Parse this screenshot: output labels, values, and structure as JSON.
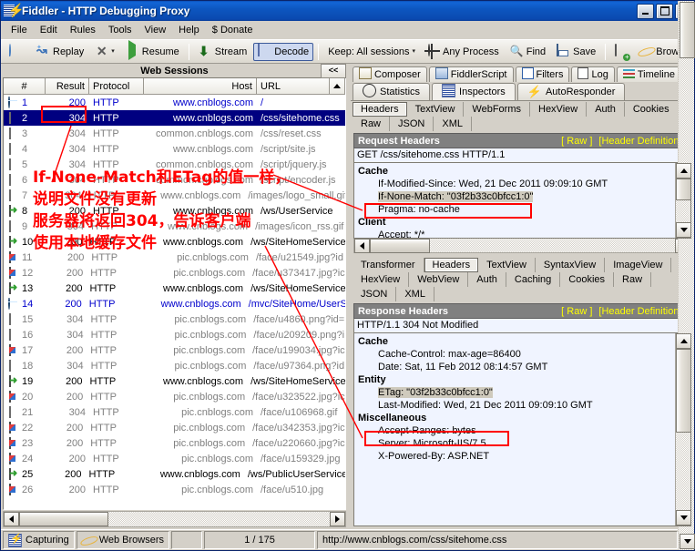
{
  "window": {
    "title": "Fiddler - HTTP Debugging Proxy",
    "icon": "fiddler-icon",
    "minimize": "_",
    "maximize": "□",
    "close": "✕"
  },
  "menu": [
    {
      "label": "File"
    },
    {
      "label": "Edit"
    },
    {
      "label": "Rules"
    },
    {
      "label": "Tools"
    },
    {
      "label": "View"
    },
    {
      "label": "Help"
    },
    {
      "label": "$ Donate"
    }
  ],
  "toolbar": {
    "comment_label": "",
    "replay_label": "Replay",
    "remove_label": "",
    "remove_caret": "▾",
    "resume_label": "Resume",
    "stream_label": "Stream",
    "decode_label": "Decode",
    "keep_label": "Keep: All sessions",
    "keep_caret": "▾",
    "process_label": "Any Process",
    "find_label": "Find",
    "save_label": "Save",
    "browse_label": "Browse",
    "overflow": "▾"
  },
  "sessions": {
    "caption": "Web Sessions",
    "collapse_label": "<<",
    "columns": [
      "#",
      "Result",
      "Protocol",
      "Host",
      "URL"
    ],
    "rows": [
      {
        "icon": "globe-icon",
        "num": "1",
        "result": "200",
        "protocol": "HTTP",
        "host": "www.cnblogs.com",
        "url": "/",
        "style": "blue"
      },
      {
        "icon": "diamond-icon",
        "num": "2",
        "result": "304",
        "protocol": "HTTP",
        "host": "www.cnblogs.com",
        "url": "/css/sitehome.css",
        "style": "sel"
      },
      {
        "icon": "diamond-icon",
        "num": "3",
        "result": "304",
        "protocol": "HTTP",
        "host": "common.cnblogs.com",
        "url": "/css/reset.css",
        "style": "gray"
      },
      {
        "icon": "diamond-icon",
        "num": "4",
        "result": "304",
        "protocol": "HTTP",
        "host": "www.cnblogs.com",
        "url": "/script/site.js",
        "style": "gray"
      },
      {
        "icon": "diamond-icon",
        "num": "5",
        "result": "304",
        "protocol": "HTTP",
        "host": "common.cnblogs.com",
        "url": "/script/jquery.js",
        "style": "gray"
      },
      {
        "icon": "diamond-icon",
        "num": "6",
        "result": "304",
        "protocol": "HTTP",
        "host": "common.cnblogs.com",
        "url": "/script/encoder.js",
        "style": "gray"
      },
      {
        "icon": "diamond-icon",
        "num": "7",
        "result": "304",
        "protocol": "HTTP",
        "host": "www.cnblogs.com",
        "url": "/images/logo_small.gif",
        "style": "gray"
      },
      {
        "icon": "arrow-icon",
        "num": "8",
        "result": "200",
        "protocol": "HTTP",
        "host": "www.cnblogs.com",
        "url": "/ws/UserService",
        "style": "black"
      },
      {
        "icon": "diamond-icon",
        "num": "9",
        "result": "304",
        "protocol": "HTTP",
        "host": "www.cnblogs.com",
        "url": "/images/icon_rss.gif",
        "style": "gray"
      },
      {
        "icon": "arrow-icon",
        "num": "10",
        "result": "200",
        "protocol": "HTTP",
        "host": "www.cnblogs.com",
        "url": "/ws/SiteHomeService",
        "style": "black"
      },
      {
        "icon": "page-icon",
        "num": "11",
        "result": "200",
        "protocol": "HTTP",
        "host": "pic.cnblogs.com",
        "url": "/face/u21549.jpg?id",
        "style": "gray"
      },
      {
        "icon": "page-icon",
        "num": "12",
        "result": "200",
        "protocol": "HTTP",
        "host": "pic.cnblogs.com",
        "url": "/face/u373417.jpg?ic",
        "style": "gray"
      },
      {
        "icon": "arrow-icon",
        "num": "13",
        "result": "200",
        "protocol": "HTTP",
        "host": "www.cnblogs.com",
        "url": "/ws/SiteHomeService",
        "style": "black"
      },
      {
        "icon": "globe-icon",
        "num": "14",
        "result": "200",
        "protocol": "HTTP",
        "host": "www.cnblogs.com",
        "url": "/mvc/SiteHome/UserS",
        "style": "blue"
      },
      {
        "icon": "diamond-icon",
        "num": "15",
        "result": "304",
        "protocol": "HTTP",
        "host": "pic.cnblogs.com",
        "url": "/face/u4860.png?id=",
        "style": "gray"
      },
      {
        "icon": "diamond-icon",
        "num": "16",
        "result": "304",
        "protocol": "HTTP",
        "host": "pic.cnblogs.com",
        "url": "/face/u209209.png?i",
        "style": "gray"
      },
      {
        "icon": "page-icon",
        "num": "17",
        "result": "200",
        "protocol": "HTTP",
        "host": "pic.cnblogs.com",
        "url": "/face/u199034.jpg?ic",
        "style": "gray"
      },
      {
        "icon": "diamond-icon",
        "num": "18",
        "result": "304",
        "protocol": "HTTP",
        "host": "pic.cnblogs.com",
        "url": "/face/u97364.png?id",
        "style": "gray"
      },
      {
        "icon": "arrow-icon",
        "num": "19",
        "result": "200",
        "protocol": "HTTP",
        "host": "www.cnblogs.com",
        "url": "/ws/SiteHomeService",
        "style": "black"
      },
      {
        "icon": "page-icon",
        "num": "20",
        "result": "200",
        "protocol": "HTTP",
        "host": "pic.cnblogs.com",
        "url": "/face/u323522.jpg?ic",
        "style": "gray"
      },
      {
        "icon": "diamond-icon",
        "num": "21",
        "result": "304",
        "protocol": "HTTP",
        "host": "pic.cnblogs.com",
        "url": "/face/u106968.gif",
        "style": "gray"
      },
      {
        "icon": "page-icon",
        "num": "22",
        "result": "200",
        "protocol": "HTTP",
        "host": "pic.cnblogs.com",
        "url": "/face/u342353.jpg?ic",
        "style": "gray"
      },
      {
        "icon": "page-icon",
        "num": "23",
        "result": "200",
        "protocol": "HTTP",
        "host": "pic.cnblogs.com",
        "url": "/face/u220660.jpg?ic",
        "style": "gray"
      },
      {
        "icon": "page-icon",
        "num": "24",
        "result": "200",
        "protocol": "HTTP",
        "host": "pic.cnblogs.com",
        "url": "/face/u159329.jpg",
        "style": "gray"
      },
      {
        "icon": "arrow-icon",
        "num": "25",
        "result": "200",
        "protocol": "HTTP",
        "host": "www.cnblogs.com",
        "url": "/ws/PublicUserService",
        "style": "black"
      },
      {
        "icon": "page-icon",
        "num": "26",
        "result": "200",
        "protocol": "HTTP",
        "host": "pic.cnblogs.com",
        "url": "/face/u510.jpg",
        "style": "gray"
      }
    ]
  },
  "right_tabs_top": [
    {
      "label": "Composer",
      "icon": "composer-icon",
      "selected": false
    },
    {
      "label": "FiddlerScript",
      "icon": "script-icon",
      "selected": false
    },
    {
      "label": "Filters",
      "icon": "filters-icon",
      "selected": false
    },
    {
      "label": "Log",
      "icon": "log-icon",
      "selected": false
    },
    {
      "label": "Timeline",
      "icon": "timeline-icon",
      "selected": false
    }
  ],
  "right_tabs_main": [
    {
      "label": "Statistics",
      "icon": "statistics-icon",
      "selected": false
    },
    {
      "label": "Inspectors",
      "icon": "inspectors-icon",
      "selected": true
    },
    {
      "label": "AutoResponder",
      "icon": "autoresponder-icon",
      "selected": false
    }
  ],
  "request": {
    "inspector_tabs": [
      {
        "label": "Headers",
        "selected": true
      },
      {
        "label": "TextView",
        "selected": false
      },
      {
        "label": "WebForms",
        "selected": false
      },
      {
        "label": "HexView",
        "selected": false
      },
      {
        "label": "Auth",
        "selected": false
      },
      {
        "label": "Cookies",
        "selected": false
      },
      {
        "label": "Raw",
        "selected": false
      },
      {
        "label": "JSON",
        "selected": false
      },
      {
        "label": "XML",
        "selected": false
      }
    ],
    "header_bar": "Request Headers",
    "link_raw": "[ Raw ]",
    "link_defs": "[Header Definitions]",
    "request_line": "GET /css/sitehome.css HTTP/1.1",
    "groups": [
      {
        "name": "Cache",
        "lines": [
          {
            "text": "If-Modified-Since: Wed, 21 Dec 2011 09:09:10 GMT",
            "highlight": false
          },
          {
            "text": "If-None-Match: \"03f2b33c0bfcc1:0\"",
            "highlight": true
          },
          {
            "text": "Pragma: no-cache",
            "highlight": false
          }
        ]
      },
      {
        "name": "Client",
        "lines": [
          {
            "text": "Accept: */*",
            "highlight": false
          }
        ]
      }
    ]
  },
  "response": {
    "inspector_tabs": [
      {
        "label": "Transformer",
        "selected": false
      },
      {
        "label": "Headers",
        "selected": true
      },
      {
        "label": "TextView",
        "selected": false
      },
      {
        "label": "SyntaxView",
        "selected": false
      },
      {
        "label": "ImageView",
        "selected": false
      },
      {
        "label": "HexView",
        "selected": false
      },
      {
        "label": "WebView",
        "selected": false
      },
      {
        "label": "Auth",
        "selected": false
      },
      {
        "label": "Caching",
        "selected": false
      },
      {
        "label": "Cookies",
        "selected": false
      },
      {
        "label": "Raw",
        "selected": false
      },
      {
        "label": "JSON",
        "selected": false
      },
      {
        "label": "XML",
        "selected": false
      }
    ],
    "header_bar": "Response Headers",
    "link_raw": "[ Raw ]",
    "link_defs": "[Header Definitions]",
    "status_line": "HTTP/1.1 304 Not Modified",
    "groups": [
      {
        "name": "Cache",
        "lines": [
          {
            "text": "Cache-Control: max-age=86400",
            "highlight": false
          },
          {
            "text": "Date: Sat, 11 Feb 2012 08:14:57 GMT",
            "highlight": false
          }
        ]
      },
      {
        "name": "Entity",
        "lines": [
          {
            "text": "ETag: \"03f2b33c0bfcc1:0\"",
            "highlight": true
          },
          {
            "text": "Last-Modified: Wed, 21 Dec 2011 09:09:10 GMT",
            "highlight": false
          }
        ]
      },
      {
        "name": "Miscellaneous",
        "lines": [
          {
            "text": "Accept-Ranges: bytes",
            "highlight": false
          },
          {
            "text": "Server: Microsoft-IIS/7.5",
            "highlight": false
          },
          {
            "text": "X-Powered-By: ASP.NET",
            "highlight": false
          }
        ]
      }
    ]
  },
  "statusbar": {
    "capturing": "Capturing",
    "browsers": "Web Browsers",
    "count": "1 / 175",
    "url": "http://www.cnblogs.com/css/sitehome.css"
  },
  "annotation": {
    "color": "#ff0000",
    "line1": "If-None-Match和ETag的值一样，",
    "line2": "说明文件没有更新",
    "line3": "服务器将返回304，告诉客户端",
    "line4": "使用本地缓存文件"
  }
}
